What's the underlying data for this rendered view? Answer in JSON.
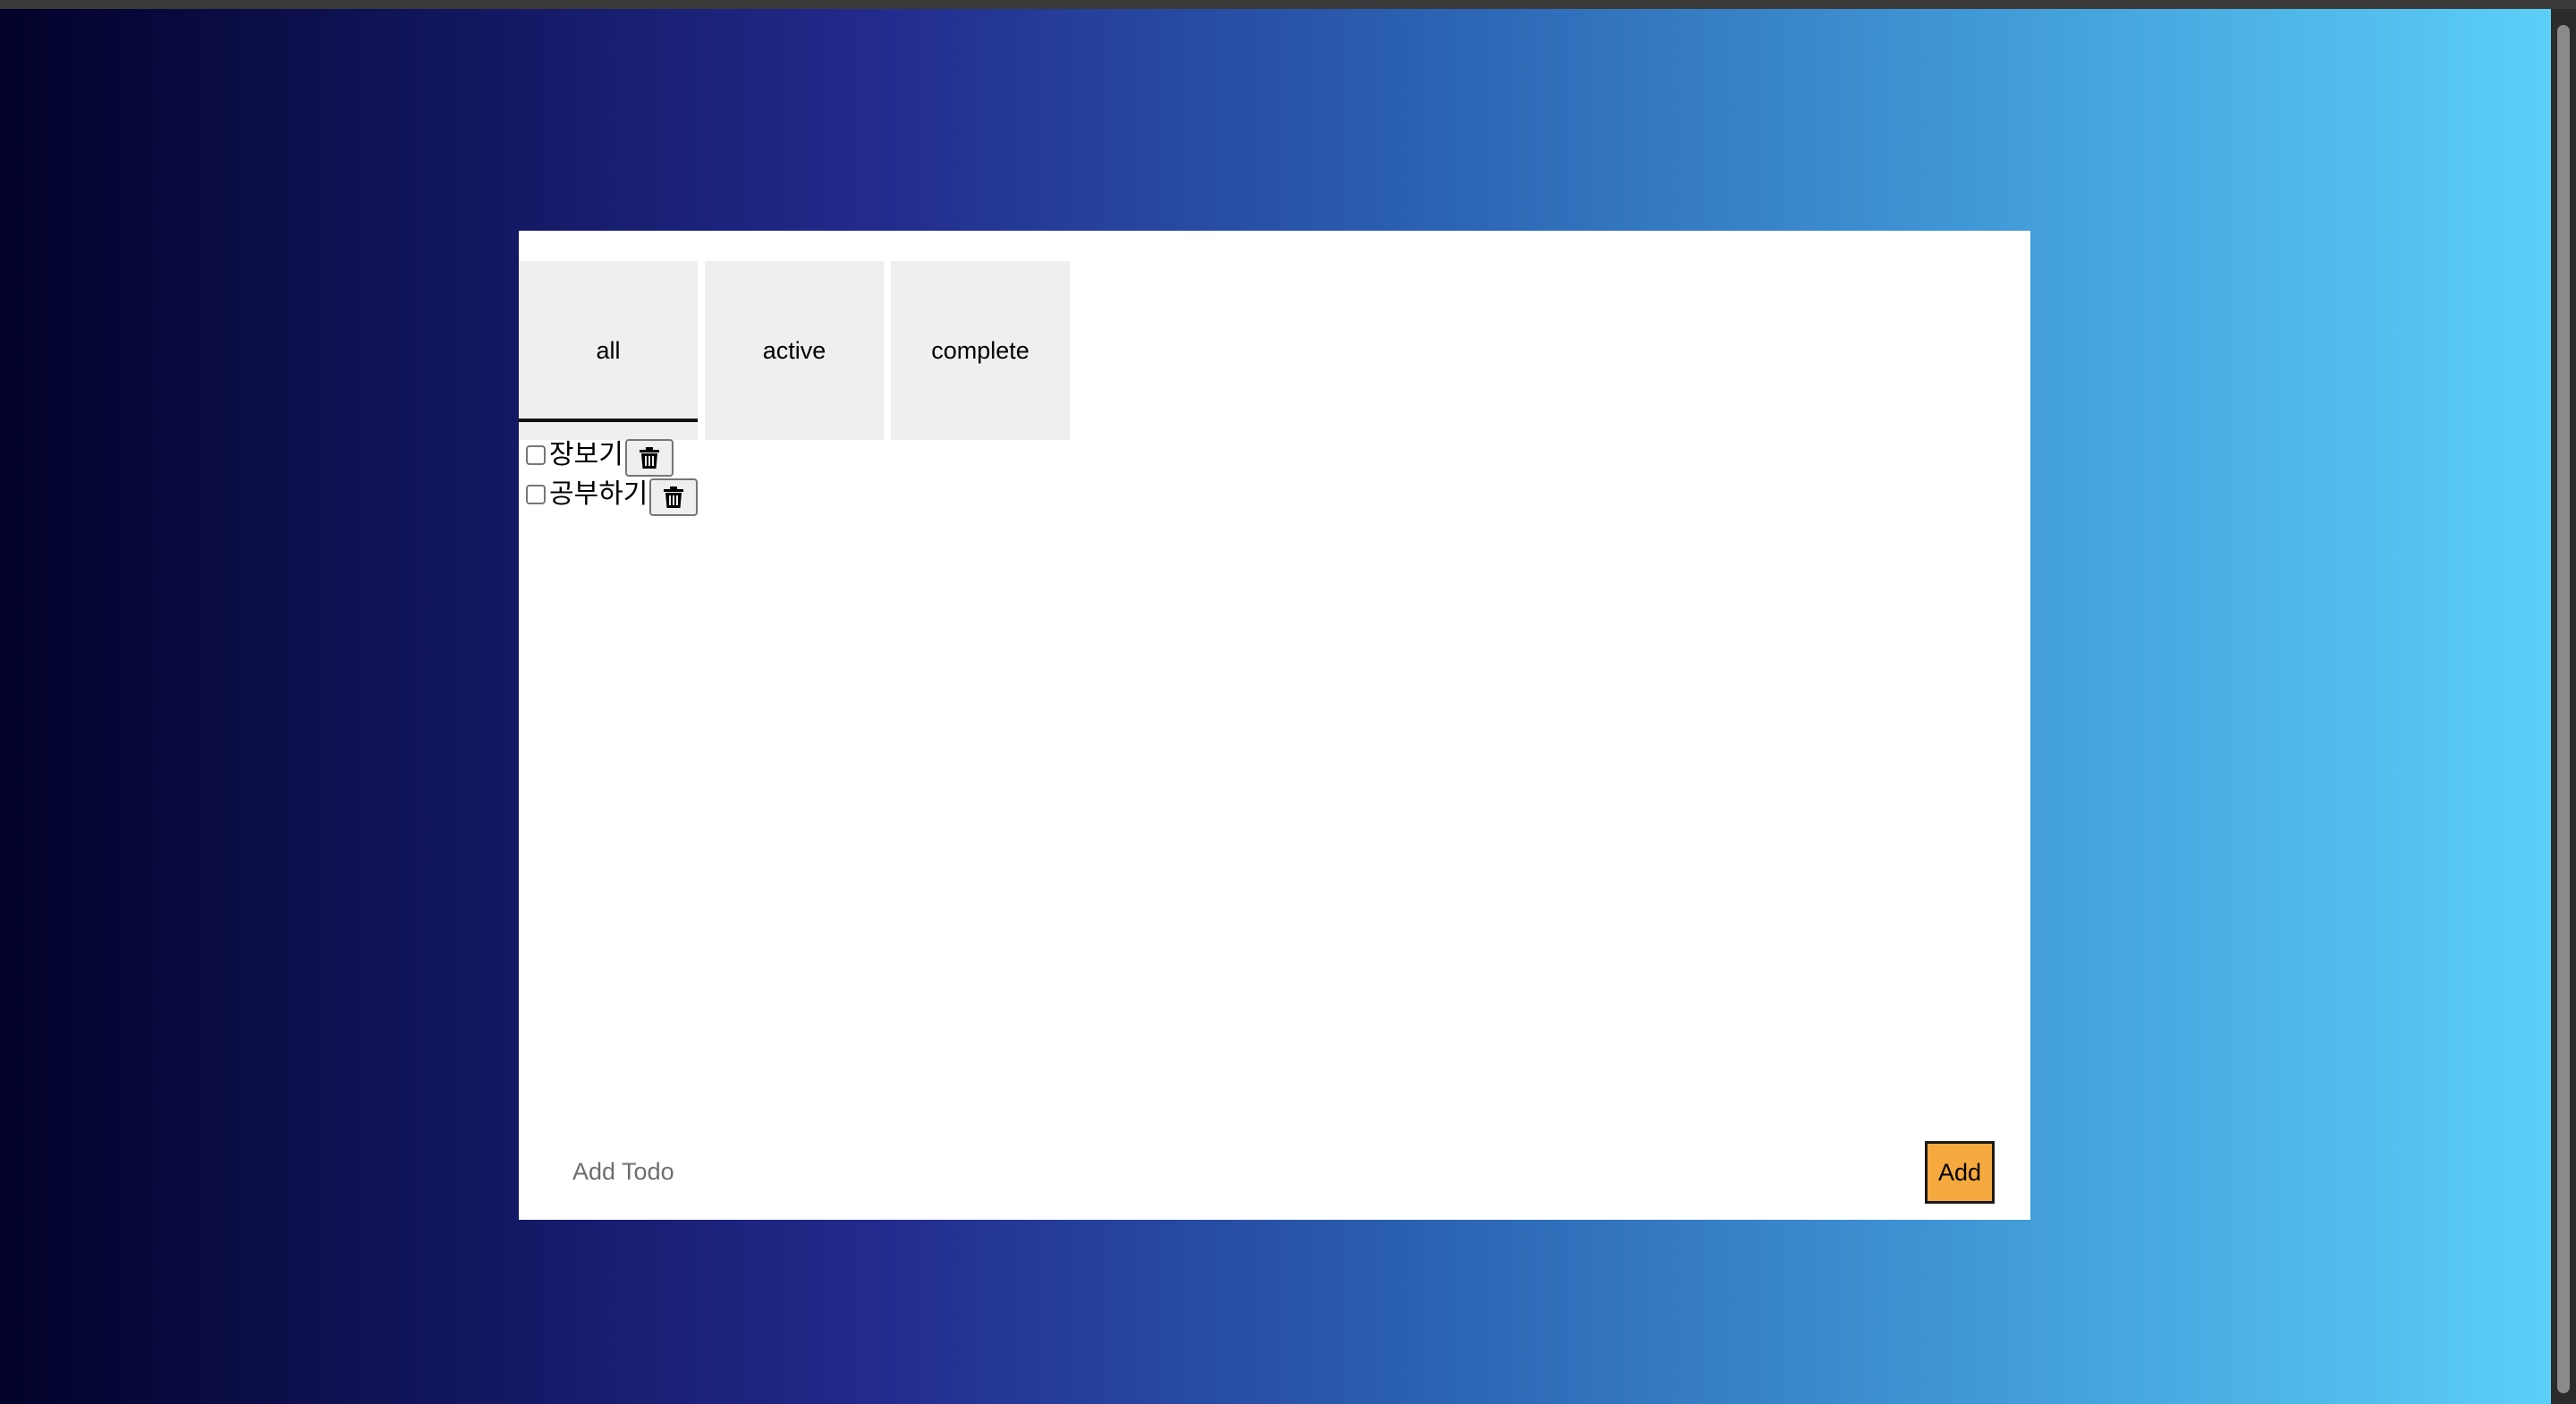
{
  "tabs": [
    {
      "label": "all",
      "selected": true
    },
    {
      "label": "active",
      "selected": false
    },
    {
      "label": "complete",
      "selected": false
    }
  ],
  "todos": [
    {
      "text": "장보기",
      "checked": false,
      "icon": "trash-icon"
    },
    {
      "text": "공부하기",
      "checked": false,
      "icon": "trash-icon"
    }
  ],
  "add": {
    "placeholder": "Add Todo",
    "button_label": "Add"
  },
  "colors": {
    "add_button": "#f5a93e",
    "tab_background": "#efefef",
    "gradient_start": "#02022a",
    "gradient_end": "#5bcff8"
  }
}
